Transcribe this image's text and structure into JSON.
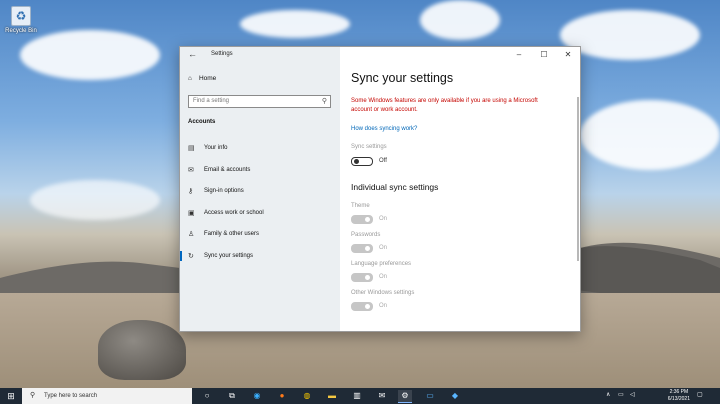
{
  "desktop": {
    "recycle_bin_label": "Recycle Bin"
  },
  "window": {
    "title": "Settings",
    "back_icon": "arrow-left-icon",
    "controls": [
      "minimize-icon",
      "maximize-icon",
      "close-icon"
    ]
  },
  "sidebar": {
    "home_label": "Home",
    "search_placeholder": "Find a setting",
    "section_title": "Accounts",
    "items": [
      {
        "label": "Your info",
        "icon": "person-card-icon"
      },
      {
        "label": "Email & accounts",
        "icon": "mail-icon"
      },
      {
        "label": "Sign-in options",
        "icon": "key-icon"
      },
      {
        "label": "Access work or school",
        "icon": "briefcase-icon"
      },
      {
        "label": "Family & other users",
        "icon": "person-icon"
      },
      {
        "label": "Sync your settings",
        "icon": "sync-icon",
        "active": true
      }
    ]
  },
  "main": {
    "title": "Sync your settings",
    "warning": "Some Windows features are only available if you are using a Microsoft account or work account.",
    "link": "How does syncing work?",
    "sync_settings_label": "Sync settings",
    "sync_settings_state": "Off",
    "individual_title": "Individual sync settings",
    "individual": [
      {
        "label": "Theme",
        "state": "On"
      },
      {
        "label": "Passwords",
        "state": "On"
      },
      {
        "label": "Language preferences",
        "state": "On"
      },
      {
        "label": "Other Windows settings",
        "state": "On"
      }
    ]
  },
  "taskbar": {
    "search_placeholder": "Type here to search",
    "time": "2:36 PM",
    "date": "6/13/2021",
    "accent_color": "#0067c0"
  }
}
